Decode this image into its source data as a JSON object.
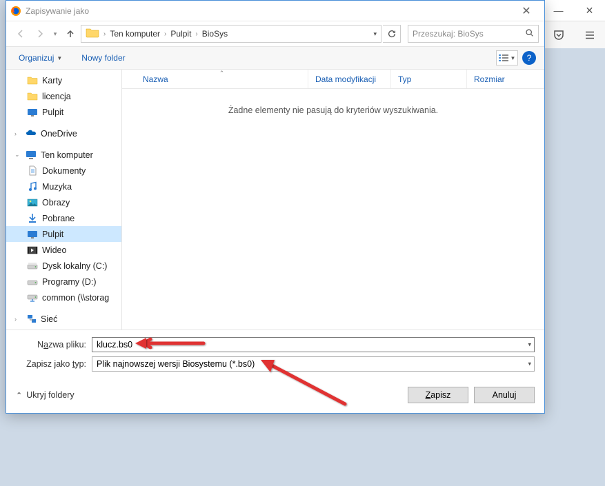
{
  "titlebar": {
    "title": "Zapisywanie jako"
  },
  "breadcrumb": {
    "root": "Ten komputer",
    "parts": [
      "Pulpit",
      "BioSys"
    ]
  },
  "search": {
    "placeholder": "Przeszukaj: BioSys"
  },
  "orgrow": {
    "organize": "Organizuj",
    "new_folder": "Nowy folder"
  },
  "list": {
    "col_name": "Nazwa",
    "col_date": "Data modyfikacji",
    "col_type": "Typ",
    "col_size": "Rozmiar",
    "empty": "Żadne elementy nie pasują do kryteriów wyszukiwania."
  },
  "tree": {
    "quick": [
      {
        "label": "Karty",
        "icon": "folder"
      },
      {
        "label": "licencja",
        "icon": "folder"
      },
      {
        "label": "Pulpit",
        "icon": "desktop"
      }
    ],
    "onedrive": "OneDrive",
    "thispc": "Ten komputer",
    "thispc_items": [
      {
        "label": "Dokumenty",
        "icon": "doc"
      },
      {
        "label": "Muzyka",
        "icon": "music"
      },
      {
        "label": "Obrazy",
        "icon": "image"
      },
      {
        "label": "Pobrane",
        "icon": "download"
      },
      {
        "label": "Pulpit",
        "icon": "desktop",
        "selected": true
      },
      {
        "label": "Wideo",
        "icon": "video"
      },
      {
        "label": "Dysk lokalny (C:)",
        "icon": "drive"
      },
      {
        "label": "Programy (D:)",
        "icon": "drive"
      },
      {
        "label": "common (\\\\storage...)",
        "icon": "netdrive",
        "truncated": "common (\\\\storag"
      }
    ],
    "network": "Sieć"
  },
  "form": {
    "filename_label_pre": "N",
    "filename_label_ul": "a",
    "filename_label_post": "zwa pliku:",
    "filename_value": "klucz.bs0",
    "type_label_pre": "Zapisz jako ",
    "type_label_ul": "t",
    "type_label_post": "yp:",
    "type_value": "Plik najnowszej wersji Biosystemu (*.bs0)"
  },
  "footer": {
    "hide_folders": "Ukryj foldery",
    "save_pre": "",
    "save_ul": "Z",
    "save_post": "apisz",
    "cancel": "Anuluj"
  }
}
